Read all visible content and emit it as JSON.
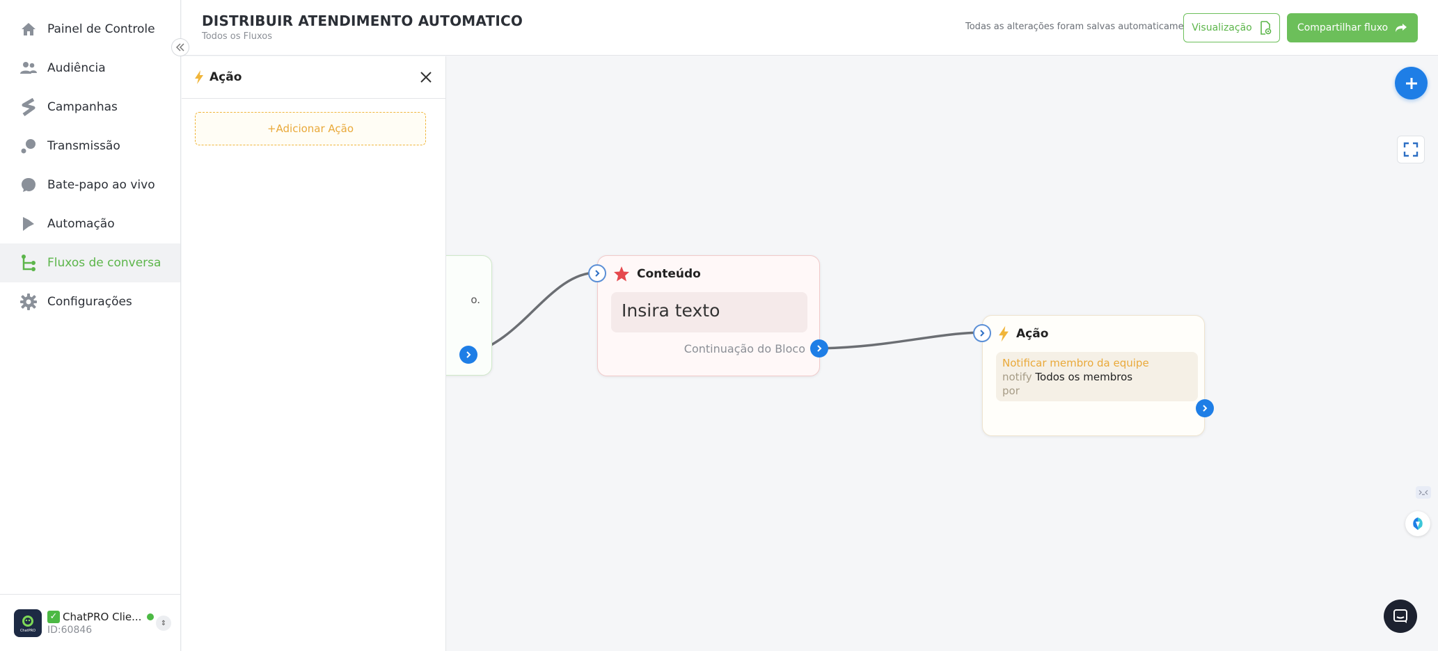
{
  "sidebar": {
    "items": [
      {
        "label": "Painel de Controle",
        "icon": "home-icon"
      },
      {
        "label": "Audiência",
        "icon": "users-icon"
      },
      {
        "label": "Campanhas",
        "icon": "campaign-icon"
      },
      {
        "label": "Transmissão",
        "icon": "broadcast-icon"
      },
      {
        "label": "Bate-papo ao vivo",
        "icon": "chat-bubble-icon"
      },
      {
        "label": "Automação",
        "icon": "automation-icon"
      },
      {
        "label": "Fluxos de conversa",
        "icon": "flow-icon"
      },
      {
        "label": "Configurações",
        "icon": "gear-icon"
      }
    ],
    "active_index": 6,
    "collapse_label": "<<",
    "account": {
      "name": "ChatPRO Clie...",
      "id": "ID:60846",
      "logo_text": "ChatPRO"
    }
  },
  "header": {
    "title": "DISTRIBUIR ATENDIMENTO AUTOMATICO",
    "breadcrumb": "Todos os Fluxos",
    "save_status": "Todas as alterações foram salvas automaticamente",
    "preview_label": "Visualização",
    "share_label": "Compartilhar fluxo"
  },
  "panel": {
    "title": "Ação",
    "add_action_label": "+Adicionar Ação"
  },
  "canvas": {
    "left_node_peek": "o.",
    "content_node": {
      "title": "Conteúdo",
      "text": "Insira texto",
      "continuation": "Continuação do Bloco"
    },
    "action_node": {
      "title": "Ação",
      "action_name": "Notificar membro da equipe",
      "notify_label": "notify",
      "notify_value": "Todos os membros",
      "by_label": "por"
    }
  },
  "colors": {
    "brand_green": "#5cb54a",
    "accent_blue": "#1e7ee6",
    "action_orange": "#e9a93a",
    "content_red": "#e5484d"
  }
}
